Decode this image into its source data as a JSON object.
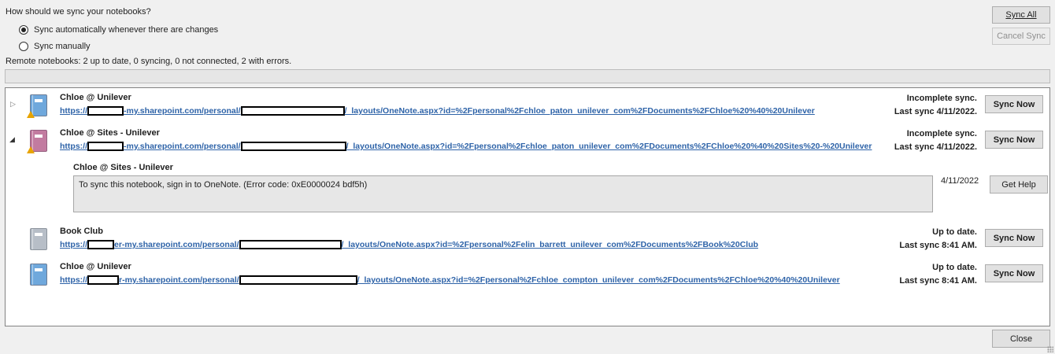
{
  "dialog": {
    "prompt": "How should we sync your notebooks?",
    "radio_auto": "Sync automatically whenever there are changes",
    "radio_manual": "Sync manually",
    "remote_status": "Remote notebooks: 2 up to date, 0 syncing, 0 not connected, 2 with errors.",
    "sync_all_label": "Sync All",
    "cancel_sync_label": "Cancel Sync",
    "close_label": "Close"
  },
  "notebooks": [
    {
      "title": "Chloe @ Unilever",
      "link_prefix": "https://",
      "link_mid": "-my.sharepoint.com/personal/",
      "link_suffix": "/_layouts/OneNote.aspx?id=%2Fpersonal%2Fchloe_paton_unilever_com%2FDocuments%2FChloe%20%40%20Unilever",
      "status1": "Incomplete sync.",
      "status2": "Last sync 4/11/2022.",
      "button": "Sync Now",
      "color": "#6fa8dc",
      "expander": "▷"
    },
    {
      "title": "Chloe @ Sites - Unilever",
      "link_prefix": "https://",
      "link_mid": "-my.sharepoint.com/personal/",
      "link_suffix": "/_layouts/OneNote.aspx?id=%2Fpersonal%2Fchloe_paton_unilever_com%2FDocuments%2FChloe%20%40%20Sites%20-%20Unilever",
      "status1": "Incomplete sync.",
      "status2": "Last sync 4/11/2022.",
      "button": "Sync Now",
      "color": "#c27ba0",
      "expander": "◢"
    },
    {
      "title": "Book Club",
      "link_prefix": "https://",
      "link_mid": "er-my.sharepoint.com/personal/",
      "link_suffix": "/_layouts/OneNote.aspx?id=%2Fpersonal%2Felin_barrett_unilever_com%2FDocuments%2FBook%20Club",
      "status1": "Up to date.",
      "status2": "Last sync 8:41 AM.",
      "button": "Sync Now",
      "color": "#b7bec7"
    },
    {
      "title": "Chloe @ Unilever",
      "link_prefix": "https://",
      "link_mid": "r-my.sharepoint.com/personal/",
      "link_suffix": "/_layouts/OneNote.aspx?id=%2Fpersonal%2Fchloe_compton_unilever_com%2FDocuments%2FChloe%20%40%20Unilever",
      "status1": "Up to date.",
      "status2": "Last sync 8:41 AM.",
      "button": "Sync Now",
      "color": "#6fa8dc"
    }
  ],
  "error_detail": {
    "section_title": "Chloe @ Sites - Unilever",
    "message": "To sync this notebook, sign in to OneNote. (Error code: 0xE0000024 bdf5h)",
    "date": "4/11/2022",
    "help_label": "Get Help"
  }
}
